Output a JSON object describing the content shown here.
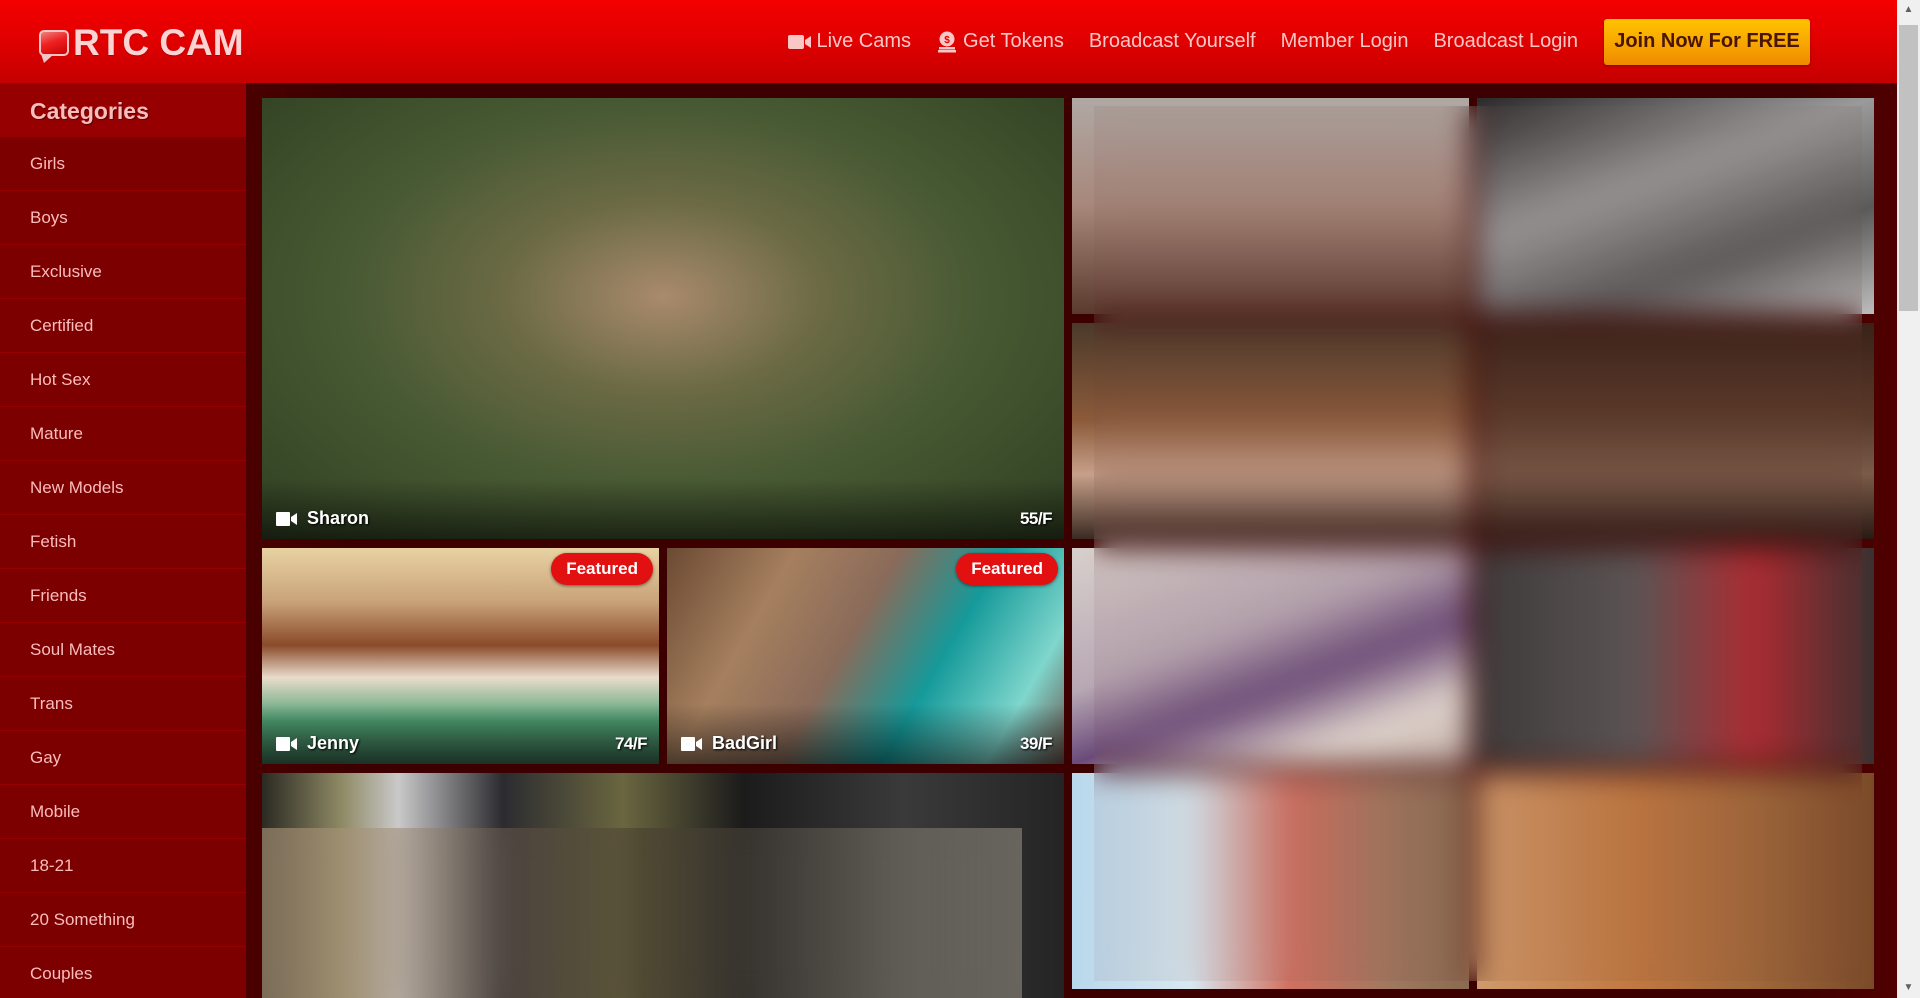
{
  "header": {
    "logo_text": "RTC CAM",
    "nav": [
      {
        "label": "Live Cams",
        "icon": "video-camera-icon"
      },
      {
        "label": "Get Tokens",
        "icon": "coin-stack-icon"
      },
      {
        "label": "Broadcast Yourself",
        "icon": null
      },
      {
        "label": "Member Login",
        "icon": null
      },
      {
        "label": "Broadcast Login",
        "icon": null
      }
    ],
    "join_button": "Join Now For FREE"
  },
  "sidebar": {
    "title": "Categories",
    "items": [
      {
        "label": "Girls"
      },
      {
        "label": "Boys"
      },
      {
        "label": "Exclusive"
      },
      {
        "label": "Certified"
      },
      {
        "label": "Hot Sex"
      },
      {
        "label": "Mature"
      },
      {
        "label": "New Models"
      },
      {
        "label": "Fetish"
      },
      {
        "label": "Friends"
      },
      {
        "label": "Soul Mates"
      },
      {
        "label": "Trans"
      },
      {
        "label": "Gay"
      },
      {
        "label": "Mobile"
      },
      {
        "label": "18-21"
      },
      {
        "label": "20 Something"
      },
      {
        "label": "Couples"
      }
    ]
  },
  "grid": {
    "featured_label": "Featured",
    "tiles": [
      {
        "name": "Sharon",
        "age_gender": "55/F",
        "featured": false
      },
      {
        "name": "Jenny",
        "age_gender": "74/F",
        "featured": true
      },
      {
        "name": "BadGirl",
        "age_gender": "39/F",
        "featured": true
      }
    ]
  },
  "colors": {
    "header_red": "#e00000",
    "sidebar_bg": "#7c0000",
    "main_bg": "#3d0000",
    "badge_red": "#e21010",
    "join_orange": "#f8a800"
  }
}
